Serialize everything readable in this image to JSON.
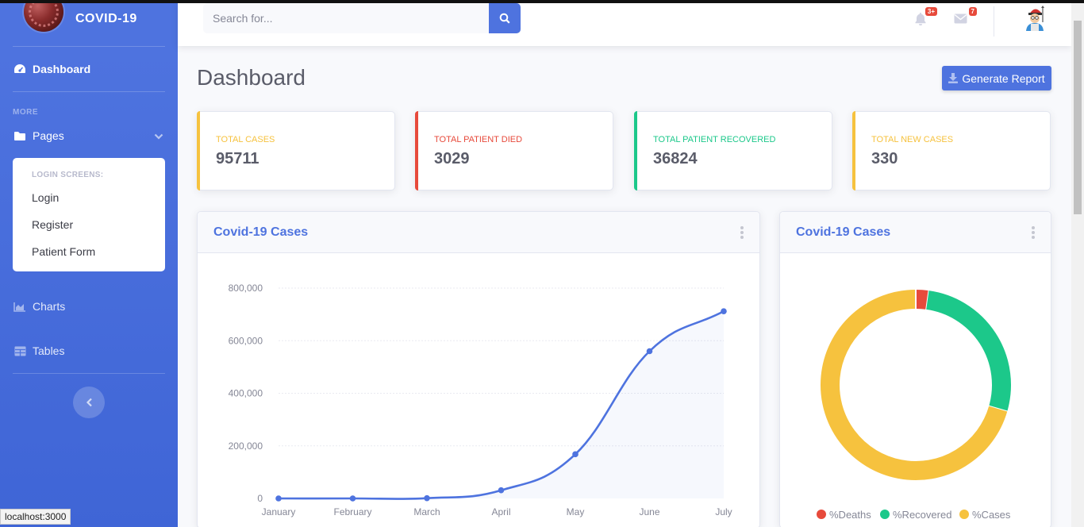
{
  "brand": {
    "name": "COVID-19"
  },
  "sidebar": {
    "dashboard_label": "Dashboard",
    "heading_more": "MORE",
    "pages_label": "Pages",
    "collapse_header": "LOGIN SCREENS:",
    "collapse_items": [
      "Login",
      "Register",
      "Patient Form"
    ],
    "charts_label": "Charts",
    "tables_label": "Tables"
  },
  "topbar": {
    "search_placeholder": "Search for...",
    "alerts_badge": "3+",
    "messages_badge": "7"
  },
  "page": {
    "title": "Dashboard",
    "report_button": "Generate Report"
  },
  "stats": [
    {
      "label": "TOTAL CASES",
      "value": "95711",
      "color": "#f6c23e"
    },
    {
      "label": "TOTAL PATIENT DIED",
      "value": "3029",
      "color": "#e74a3b"
    },
    {
      "label": "TOTAL PATIENT RECOVERED",
      "value": "36824",
      "color": "#1cc88a"
    },
    {
      "label": "TOTAL NEW CASES",
      "value": "330",
      "color": "#f6c23e"
    }
  ],
  "area_card": {
    "title": "Covid-19 Cases"
  },
  "pie_card": {
    "title": "Covid-19 Cases"
  },
  "status_bar": {
    "url": "localhost:3000"
  },
  "chart_data": [
    {
      "type": "line",
      "title": "Covid-19 Cases",
      "categories": [
        "January",
        "February",
        "March",
        "April",
        "May",
        "June",
        "July"
      ],
      "values": [
        0,
        0,
        1000,
        31000,
        168000,
        560000,
        712000
      ],
      "ylim": [
        0,
        800000
      ],
      "yticks": [
        "0",
        "200,000",
        "400,000",
        "600,000",
        "800,000"
      ],
      "color": "#4e73df",
      "fill": "rgba(78,115,223,0.05)",
      "grid": true
    },
    {
      "type": "pie",
      "title": "Covid-19 Cases",
      "labels": [
        "%Deaths",
        "%Recovered",
        "%Cases"
      ],
      "values": [
        2.2,
        27.3,
        70.5
      ],
      "colors": [
        "#e74a3b",
        "#1cc88a",
        "#f6c23e"
      ],
      "legend": "bottom"
    }
  ]
}
